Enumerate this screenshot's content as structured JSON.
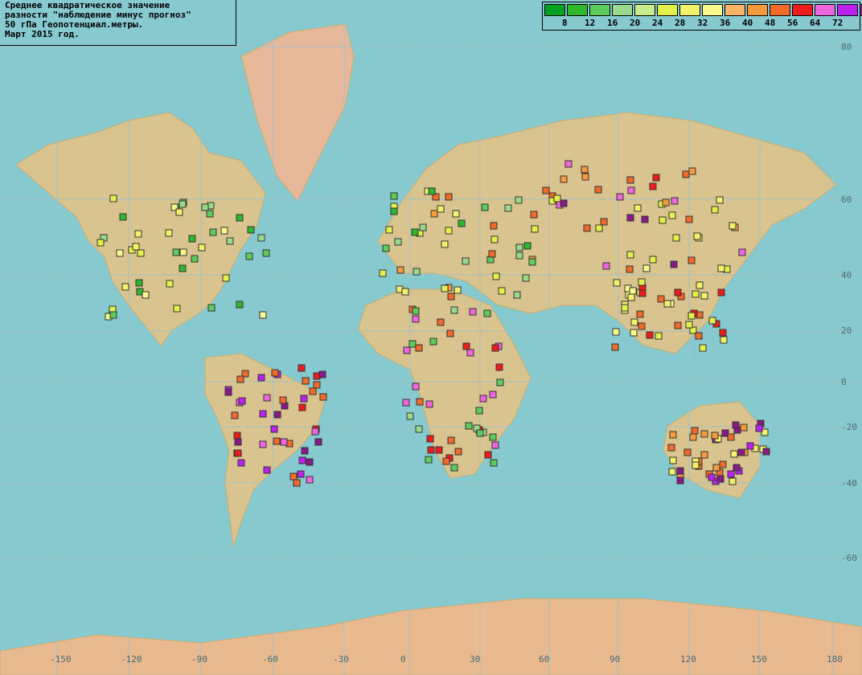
{
  "title": {
    "lines": [
      "Среднее квадратическое значение",
      "разности \"наблюдение минус прогноз\"",
      "50 гПа Геопотенциал.метры.",
      "Март 2015 год."
    ]
  },
  "legend": {
    "colors": [
      "#00a020",
      "#2eb82e",
      "#5ccc5c",
      "#9ad98c",
      "#c8ec8c",
      "#e4f04a",
      "#f2f26a",
      "#fafa8c",
      "#f7b267",
      "#f79a3c",
      "#f26a2a",
      "#ee1c1c",
      "#ee66dd",
      "#bb22ee",
      "#8a1a8a"
    ],
    "labels": [
      "8",
      "12",
      "16",
      "20",
      "24",
      "28",
      "32",
      "36",
      "40",
      "48",
      "56",
      "64",
      "72"
    ]
  },
  "axes": {
    "lon_labels": [
      "-150",
      "-120",
      "-90",
      "-60",
      "-30",
      "0",
      "30",
      "60",
      "90",
      "120",
      "150",
      "180"
    ],
    "lat_labels": [
      "80",
      "60",
      "40",
      "20",
      "0",
      "-20",
      "-40",
      "-60"
    ]
  }
}
